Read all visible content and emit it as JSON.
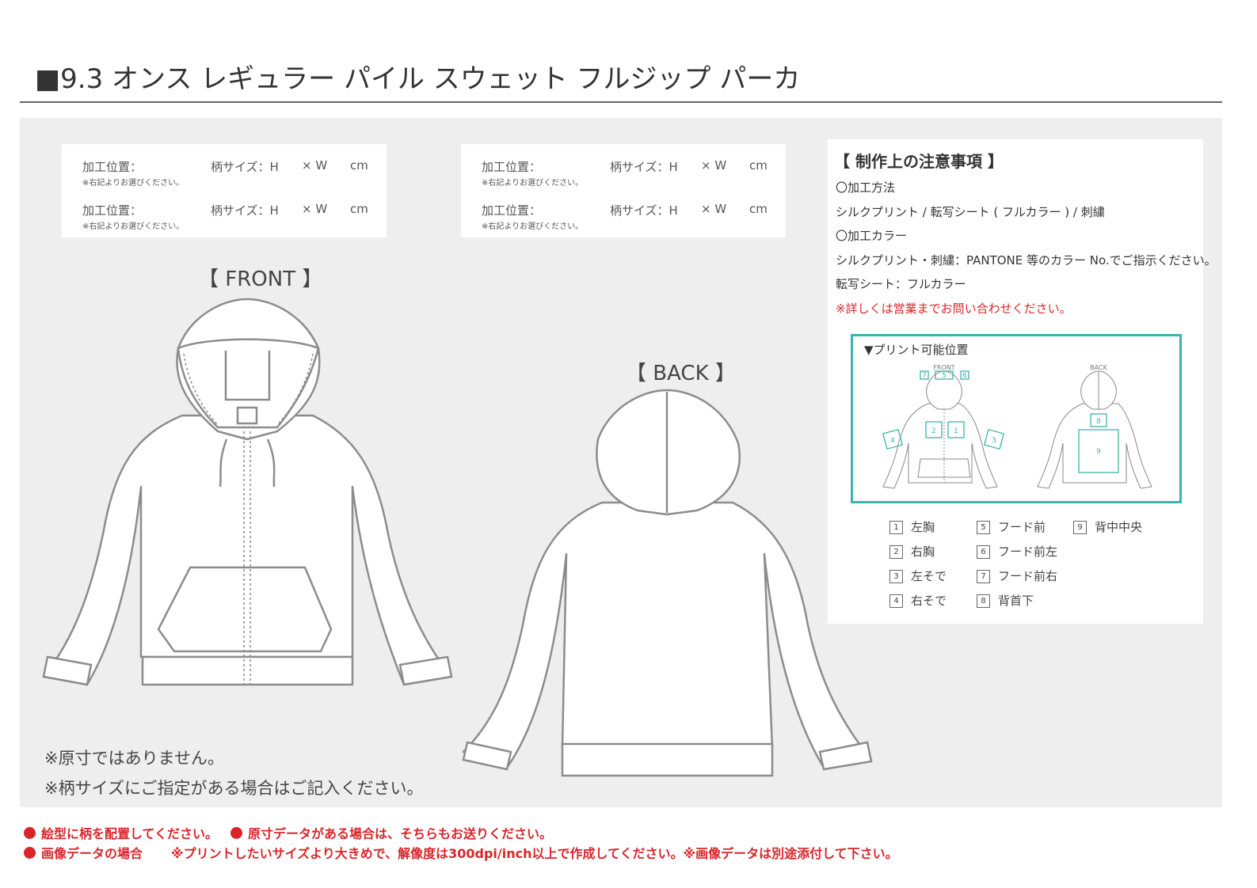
{
  "title": "■9.3 オンス レギュラー パイル スウェット フルジップ パーカ",
  "placement_forms": [
    {
      "rows": [
        {
          "label": "加工位置：",
          "note": "※右記よりお選びください。",
          "size": "柄サイズ：H",
          "w": "× W",
          "unit": "cm"
        },
        {
          "label": "加工位置：",
          "note": "※右記よりお選びください。",
          "size": "柄サイズ：H",
          "w": "× W",
          "unit": "cm"
        }
      ]
    },
    {
      "rows": [
        {
          "label": "加工位置：",
          "note": "※右記よりお選びください。",
          "size": "柄サイズ：H",
          "w": "× W",
          "unit": "cm"
        },
        {
          "label": "加工位置：",
          "note": "※右記よりお選びください。",
          "size": "柄サイズ：H",
          "w": "× W",
          "unit": "cm"
        }
      ]
    }
  ],
  "views": {
    "front_label": "【 FRONT 】",
    "back_label": "【 BACK 】"
  },
  "notes_panel": {
    "heading": "【 制作上の注意事項 】",
    "lines": [
      "〇加工方法",
      "シルクプリント / 転写シート ( フルカラー ) / 刺繍",
      "〇加工カラー",
      "シルクプリント・刺繍：PANTONE 等のカラー No.でご指示ください。",
      "転写シート：フルカラー"
    ],
    "red_note": "※詳しくは営業までお問い合わせください。",
    "print_positions": {
      "title": "▼プリント可能位置",
      "front_caption": "FRONT",
      "back_caption": "BACK",
      "front_markers": [
        "7",
        "5",
        "6",
        "2",
        "1",
        "4",
        "3"
      ],
      "back_markers": [
        "8",
        "9"
      ],
      "accent_color": "#3bb3ae"
    },
    "legend": [
      {
        "num": "1",
        "label": "左胸"
      },
      {
        "num": "2",
        "label": "右胸"
      },
      {
        "num": "3",
        "label": "左そで"
      },
      {
        "num": "4",
        "label": "右そで"
      },
      {
        "num": "5",
        "label": "フード前"
      },
      {
        "num": "6",
        "label": "フード前左"
      },
      {
        "num": "7",
        "label": "フード前右"
      },
      {
        "num": "8",
        "label": "背首下"
      },
      {
        "num": "9",
        "label": "背中中央"
      }
    ]
  },
  "bottom_notes": [
    "※原寸ではありません。",
    "※柄サイズにご指定がある場合はご記入ください。"
  ],
  "footer": {
    "line1_a": "絵型に柄を配置してください。",
    "line1_b": "原寸データがある場合は、そちらもお送りください。",
    "line2_a": "画像データの場合",
    "line2_b": "※プリントしたいサイズより大きめで、解像度は300dpi/inch以上で作成してください。※画像データは別途添付して下さい。",
    "accent_color": "#d9252a"
  }
}
